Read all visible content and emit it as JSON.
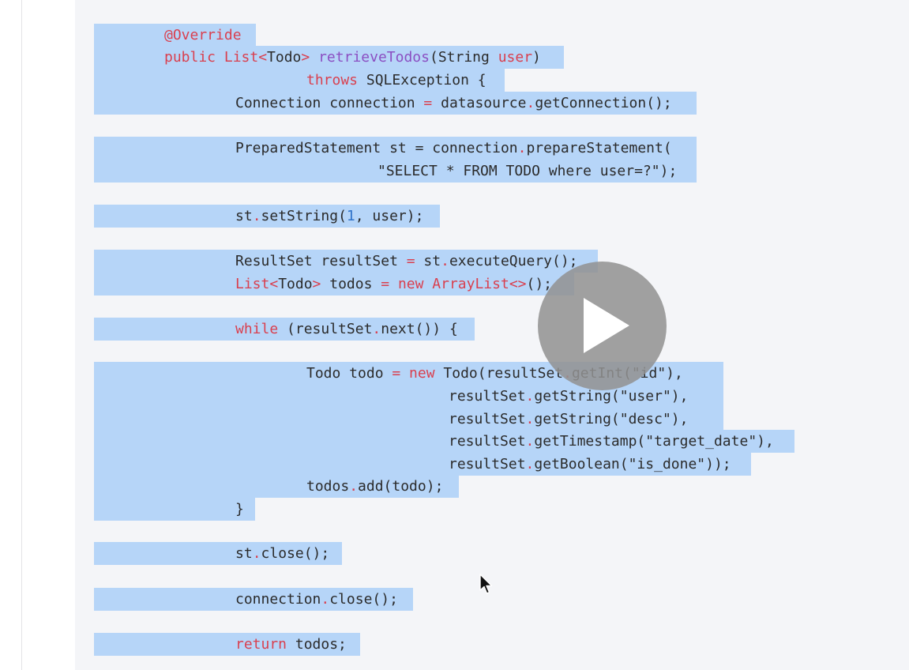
{
  "player": {
    "play_label": "Play video"
  },
  "code": {
    "language": "java",
    "lines": [
      [
        [
          "an",
          "@Override"
        ]
      ],
      [
        [
          "kw",
          "public "
        ],
        [
          "kw",
          "List<"
        ],
        [
          "pl",
          "Todo"
        ],
        [
          "kw",
          "> "
        ],
        [
          "fn",
          "retrieveTodos"
        ],
        [
          "pl",
          "(String "
        ],
        [
          "kw",
          "user"
        ],
        [
          "pl",
          ")"
        ]
      ],
      [
        [
          "kw",
          "throws "
        ],
        [
          "pl",
          "SQLException {"
        ]
      ],
      [
        [
          "pl",
          "Connection connection "
        ],
        [
          "kw",
          "="
        ],
        [
          "pl",
          " datasource"
        ],
        [
          "kw",
          "."
        ],
        [
          "pl",
          "getConnection();"
        ]
      ],
      [
        [
          "pl",
          "PreparedStatement st = connection"
        ],
        [
          "kw",
          "."
        ],
        [
          "pl",
          "prepareStatement("
        ]
      ],
      [
        [
          "st",
          "\"SELECT * FROM TODO where user=?\");"
        ]
      ],
      [
        [
          "pl",
          "st"
        ],
        [
          "kw",
          "."
        ],
        [
          "pl",
          "setString("
        ],
        [
          "nm",
          "1"
        ],
        [
          "pl",
          ", user);"
        ]
      ],
      [
        [
          "pl",
          "ResultSet resultSet "
        ],
        [
          "kw",
          "="
        ],
        [
          "pl",
          " st"
        ],
        [
          "kw",
          "."
        ],
        [
          "pl",
          "executeQuery();"
        ]
      ],
      [
        [
          "kw",
          "List<"
        ],
        [
          "pl",
          "Todo"
        ],
        [
          "kw",
          "> "
        ],
        [
          "pl",
          "todos "
        ],
        [
          "kw",
          "= new ArrayList<>"
        ],
        [
          "pl",
          "();"
        ]
      ],
      [
        [
          "kw",
          "while "
        ],
        [
          "pl",
          "(resultSet"
        ],
        [
          "kw",
          "."
        ],
        [
          "pl",
          "next()) {"
        ]
      ],
      [
        [
          "pl",
          "Todo todo "
        ],
        [
          "kw",
          "= new "
        ],
        [
          "pl",
          "Todo(resultSet"
        ],
        [
          "kw",
          "."
        ],
        [
          "pl",
          "getInt(\"id\"),"
        ]
      ],
      [
        [
          "pl",
          "resultSet"
        ],
        [
          "kw",
          "."
        ],
        [
          "pl",
          "getString(\"user\"),"
        ]
      ],
      [
        [
          "pl",
          "resultSet"
        ],
        [
          "kw",
          "."
        ],
        [
          "pl",
          "getString(\"desc\"),"
        ]
      ],
      [
        [
          "pl",
          "resultSet"
        ],
        [
          "kw",
          "."
        ],
        [
          "pl",
          "getTimestamp(\"target_date\"),"
        ]
      ],
      [
        [
          "pl",
          "resultSet"
        ],
        [
          "kw",
          "."
        ],
        [
          "pl",
          "getBoolean(\"is_done\"));"
        ]
      ],
      [
        [
          "pl",
          "todos"
        ],
        [
          "kw",
          "."
        ],
        [
          "pl",
          "add(todo);"
        ]
      ],
      [
        [
          "pl",
          "}"
        ]
      ],
      [
        [
          "pl",
          "st"
        ],
        [
          "kw",
          "."
        ],
        [
          "pl",
          "close();"
        ]
      ],
      [
        [
          "pl",
          "connection"
        ],
        [
          "kw",
          "."
        ],
        [
          "pl",
          "close();"
        ]
      ],
      [
        [
          "kw",
          "return "
        ],
        [
          "pl",
          "todos;"
        ]
      ]
    ]
  }
}
